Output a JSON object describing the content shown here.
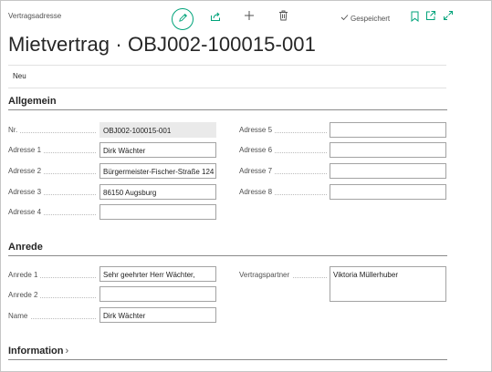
{
  "card": {
    "caption": "Vertragsadresse",
    "title": "Mietvertrag · OBJ002-100015-001",
    "saved_label": "Gespeichert"
  },
  "toolbar": {
    "icons": [
      "pencil-icon",
      "share-icon",
      "plus-icon",
      "trash-icon",
      "bookmark-icon",
      "popout-icon",
      "expand-icon"
    ]
  },
  "actions": {
    "new_label": "Neu"
  },
  "sections": {
    "allgemein": "Allgemein",
    "anrede": "Anrede",
    "information": "Information"
  },
  "allgemein": {
    "nr": {
      "label": "Nr.",
      "value": "OBJ002-100015-001"
    },
    "adresse1": {
      "label": "Adresse 1",
      "value": "Dirk Wächter"
    },
    "adresse2": {
      "label": "Adresse 2",
      "value": "Bürgermeister-Fischer-Straße 124"
    },
    "adresse3": {
      "label": "Adresse 3",
      "value": "86150 Augsburg"
    },
    "adresse4": {
      "label": "Adresse 4",
      "value": ""
    },
    "adresse5": {
      "label": "Adresse 5",
      "value": ""
    },
    "adresse6": {
      "label": "Adresse 6",
      "value": ""
    },
    "adresse7": {
      "label": "Adresse 7",
      "value": ""
    },
    "adresse8": {
      "label": "Adresse 8",
      "value": ""
    }
  },
  "anrede": {
    "anrede1": {
      "label": "Anrede 1",
      "value": "Sehr geehrter Herr Wächter,"
    },
    "anrede2": {
      "label": "Anrede 2",
      "value": ""
    },
    "name": {
      "label": "Name",
      "value": "Dirk Wächter"
    },
    "vertragspartner": {
      "label": "Vertragspartner",
      "value": "Viktoria Müllerhuber"
    }
  },
  "colors": {
    "accent": "#00a37a",
    "border": "#a3a3a3",
    "readonly_bg": "#eaeaea"
  }
}
